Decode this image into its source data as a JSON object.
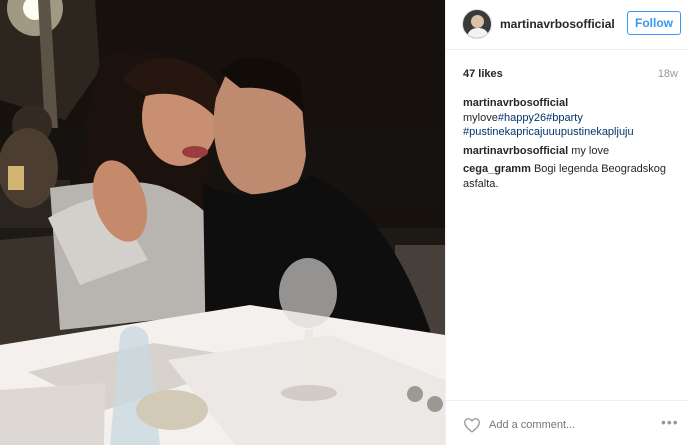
{
  "post": {
    "image_alt": "",
    "menu_text": "",
    "username": "martinavrbosofficial",
    "follow_label": "Follow",
    "likes": "47 likes",
    "age": "18w"
  },
  "comments": [
    {
      "user": "martinavrbosofficial",
      "text": "mylove",
      "tags": "#happy26#bparty #pustinekapricajuuupustinekapljuju"
    },
    {
      "user": "martinavrbosofficial",
      "text": "my love",
      "tags": ""
    },
    {
      "user": "cega_gramm",
      "text": "Bogi legenda Beogradskog asfalta.",
      "tags": ""
    }
  ],
  "footer": {
    "comment_placeholder": "Add a comment...",
    "more_label": "•••"
  },
  "colors": {
    "accent": "#3897f0",
    "hashtag": "#003569",
    "text": "#262626",
    "muted": "#999999"
  },
  "icons": [
    "heart-icon",
    "more-options-icon"
  ]
}
